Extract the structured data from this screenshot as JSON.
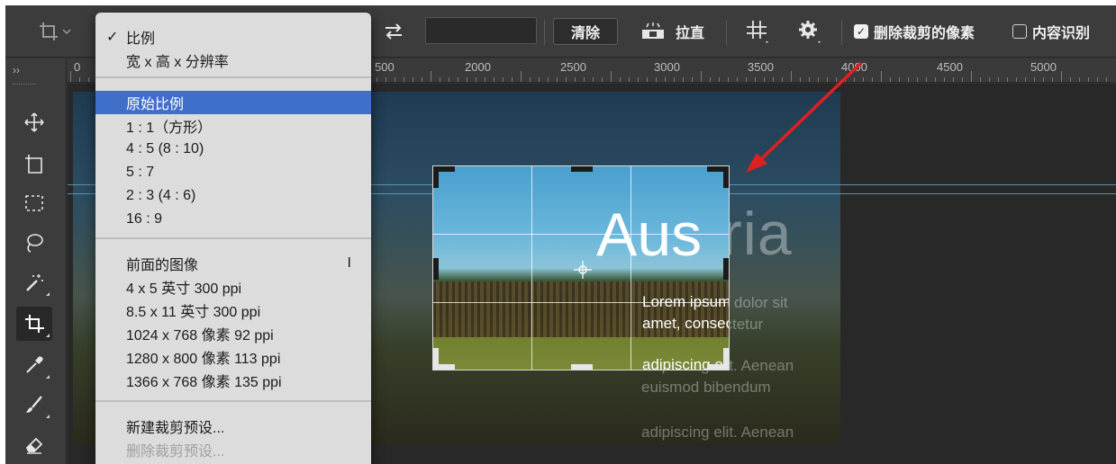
{
  "options_bar": {
    "clear_button": "清除",
    "straighten_label": "拉直",
    "delete_cropped_pixels_label": "删除裁剪的像素",
    "delete_cropped_pixels_checked": "✓",
    "content_aware_label": "内容识别",
    "icons": [
      "crop-tool-icon",
      "swap-icon",
      "straighten-level-icon",
      "grid-overlay-icon",
      "settings-gear-icon"
    ]
  },
  "ruler": {
    "labels": [
      "0",
      "500",
      "2000",
      "2500",
      "3000",
      "3500",
      "4000",
      "4500",
      "5000"
    ],
    "toolbar_collapse": "››"
  },
  "toolbar": {
    "tools": [
      "move-tool-icon",
      "artboard-tool-icon",
      "marquee-tool-icon",
      "lasso-tool-icon",
      "magic-wand-icon",
      "crop-tool-icon",
      "eyedropper-icon",
      "brush-icon",
      "eraser-icon"
    ]
  },
  "canvas": {
    "title": "Austria",
    "title_inside": "Aus",
    "title_outside": "tria",
    "paragraph_line1": "Lorem ipsum dolor sit",
    "paragraph_line2": "amet, consectetur",
    "paragraph_line3": "adipiscing elit. Aenean",
    "paragraph_line4": "euismod bibendum",
    "paragraph_line5": "adipiscing elit. Aenean"
  },
  "menu": {
    "items": [
      {
        "label": "比例",
        "check": "✓"
      },
      {
        "label": "宽 x 高 x 分辨率"
      },
      {
        "label": "原始比例"
      },
      {
        "label": "1 : 1（方形）"
      },
      {
        "label": "4 : 5 (8 : 10)"
      },
      {
        "label": "5 : 7"
      },
      {
        "label": "2 : 3 (4 : 6)"
      },
      {
        "label": "16 : 9"
      },
      {
        "label": "前面的图像",
        "shortcut": "I"
      },
      {
        "label": "4 x 5 英寸 300 ppi"
      },
      {
        "label": "8.5 x 11 英寸 300 ppi"
      },
      {
        "label": "1024 x 768 像素 92 ppi"
      },
      {
        "label": "1280 x 800 像素 113 ppi"
      },
      {
        "label": "1366 x 768 像素 135 ppi"
      },
      {
        "label": "新建裁剪预设..."
      },
      {
        "label": "删除裁剪预设..."
      }
    ]
  },
  "colors": {
    "menu_selection": "#3f6fc9",
    "annotation_arrow": "#e02020",
    "guide_line": "#6aa8c6"
  }
}
